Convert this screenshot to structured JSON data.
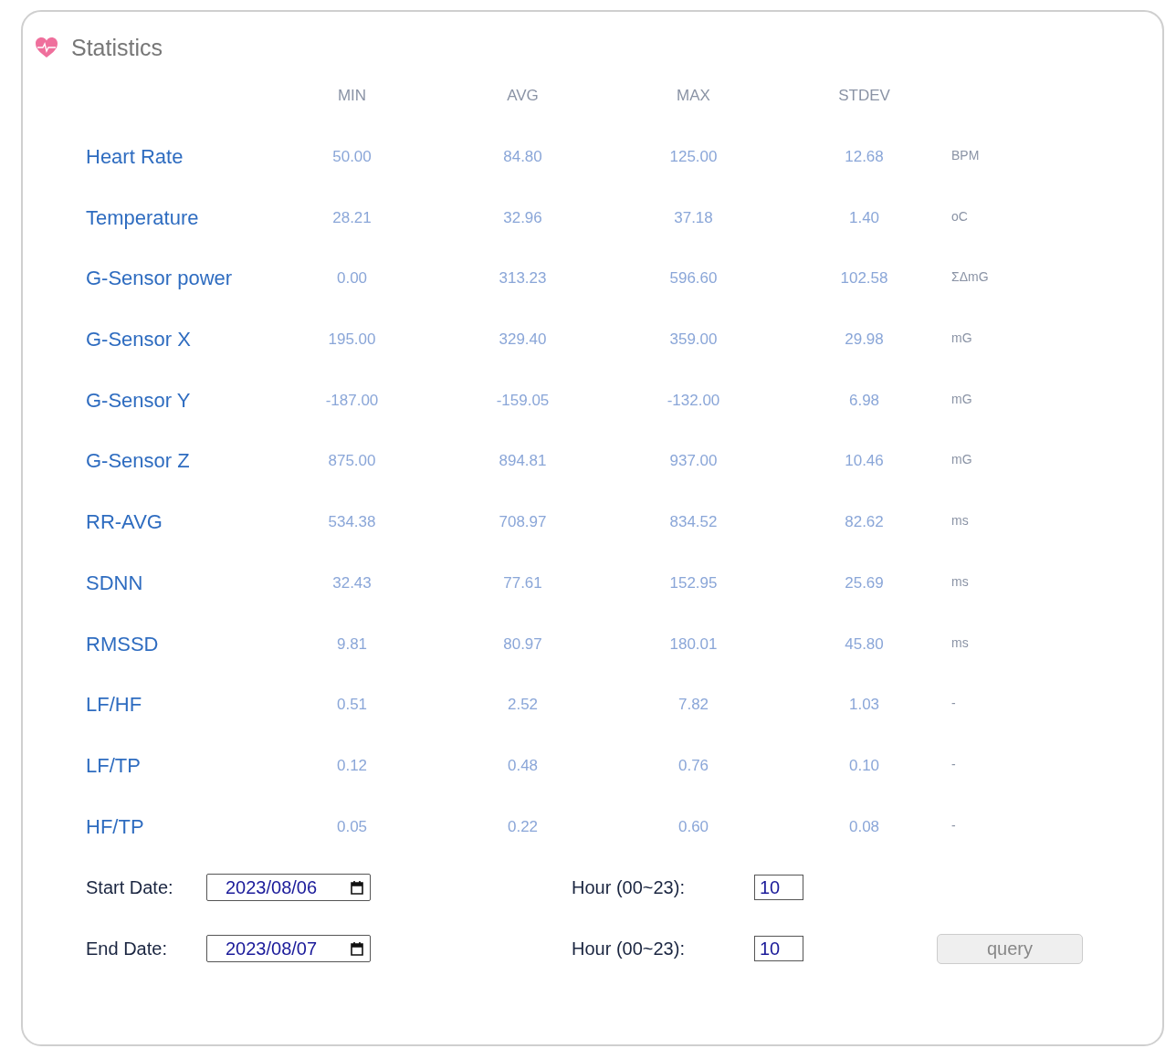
{
  "title": "Statistics",
  "columns": [
    "MIN",
    "AVG",
    "MAX",
    "STDEV"
  ],
  "rows": [
    {
      "label": "Heart Rate",
      "values": [
        "50.00",
        "84.80",
        "125.00",
        "12.68"
      ],
      "unit": "BPM"
    },
    {
      "label": "Temperature",
      "values": [
        "28.21",
        "32.96",
        "37.18",
        "1.40"
      ],
      "unit": "oC"
    },
    {
      "label": "G-Sensor power",
      "values": [
        "0.00",
        "313.23",
        "596.60",
        "102.58"
      ],
      "unit": "ΣΔmG"
    },
    {
      "label": "G-Sensor X",
      "values": [
        "195.00",
        "329.40",
        "359.00",
        "29.98"
      ],
      "unit": "mG"
    },
    {
      "label": "G-Sensor Y",
      "values": [
        "-187.00",
        "-159.05",
        "-132.00",
        "6.98"
      ],
      "unit": "mG"
    },
    {
      "label": "G-Sensor Z",
      "values": [
        "875.00",
        "894.81",
        "937.00",
        "10.46"
      ],
      "unit": "mG"
    },
    {
      "label": "RR-AVG",
      "values": [
        "534.38",
        "708.97",
        "834.52",
        "82.62"
      ],
      "unit": "ms"
    },
    {
      "label": "SDNN",
      "values": [
        "32.43",
        "77.61",
        "152.95",
        "25.69"
      ],
      "unit": "ms"
    },
    {
      "label": "RMSSD",
      "values": [
        "9.81",
        "80.97",
        "180.01",
        "45.80"
      ],
      "unit": "ms"
    },
    {
      "label": "LF/HF",
      "values": [
        "0.51",
        "2.52",
        "7.82",
        "1.03"
      ],
      "unit": "-"
    },
    {
      "label": "LF/TP",
      "values": [
        "0.12",
        "0.48",
        "0.76",
        "0.10"
      ],
      "unit": "-"
    },
    {
      "label": "HF/TP",
      "values": [
        "0.05",
        "0.22",
        "0.60",
        "0.08"
      ],
      "unit": "-"
    }
  ],
  "form": [
    {
      "label": "Start Date:",
      "date": "2023/08/06",
      "hour_label": "Hour (00~23):",
      "hour": "10"
    },
    {
      "label": "End Date:",
      "date": "2023/08/07",
      "hour_label": "Hour (00~23):",
      "hour": "10"
    }
  ],
  "button": "query"
}
